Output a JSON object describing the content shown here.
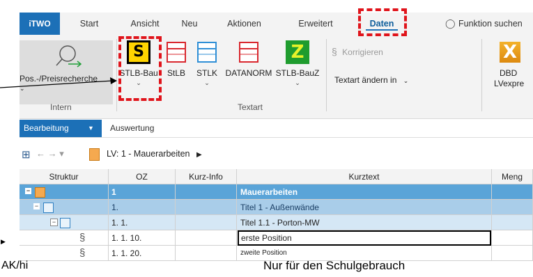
{
  "ribbon_tabs": [
    "iTWO",
    "Start",
    "Ansicht",
    "Neu",
    "Aktionen",
    "Erweitert",
    "Daten"
  ],
  "search_label": "Funktion suchen",
  "groups": {
    "intern": {
      "label": "Intern",
      "button": "Pos.-/Preisrecherche"
    },
    "textart": {
      "label": "Textart",
      "buttons": [
        "STLB-Bau",
        "StLB",
        "STLK",
        "DATANORM",
        "STLB-BauZ"
      ],
      "korrigieren": "Korrigieren",
      "textart_aendern": "Textart ändern in"
    },
    "dbd": {
      "line1": "DBD",
      "line2": "LVexpre"
    }
  },
  "subtabs": [
    "Bearbeitung",
    "Auswertung"
  ],
  "nav": {
    "breadcrumb": "LV: 1 - Mauerarbeiten"
  },
  "table": {
    "headers": [
      "Struktur",
      "OZ",
      "Kurz-Info",
      "Kurztext",
      "Meng"
    ],
    "rows": [
      {
        "oz": "1",
        "kurztext": "Mauerarbeiten"
      },
      {
        "oz": "1.",
        "kurztext": "Titel 1 - Außenwände"
      },
      {
        "oz": "1. 1.",
        "kurztext": "Titel 1.1 - Porton-MW"
      },
      {
        "oz": "1. 1. 10.",
        "kurztext": "erste Position"
      },
      {
        "oz": "1. 1. 20.",
        "kurztext": "zweite Position"
      }
    ]
  },
  "overlay": {
    "watermark": "Nur für den Schulgebrauch",
    "author": "AK/hi"
  },
  "colors": {
    "accent": "#1c70b7",
    "highlight": "#e0141b",
    "row_level1": "#5aa4d8",
    "row_level2": "#a9cde9",
    "row_level3": "#d5e7f5"
  }
}
